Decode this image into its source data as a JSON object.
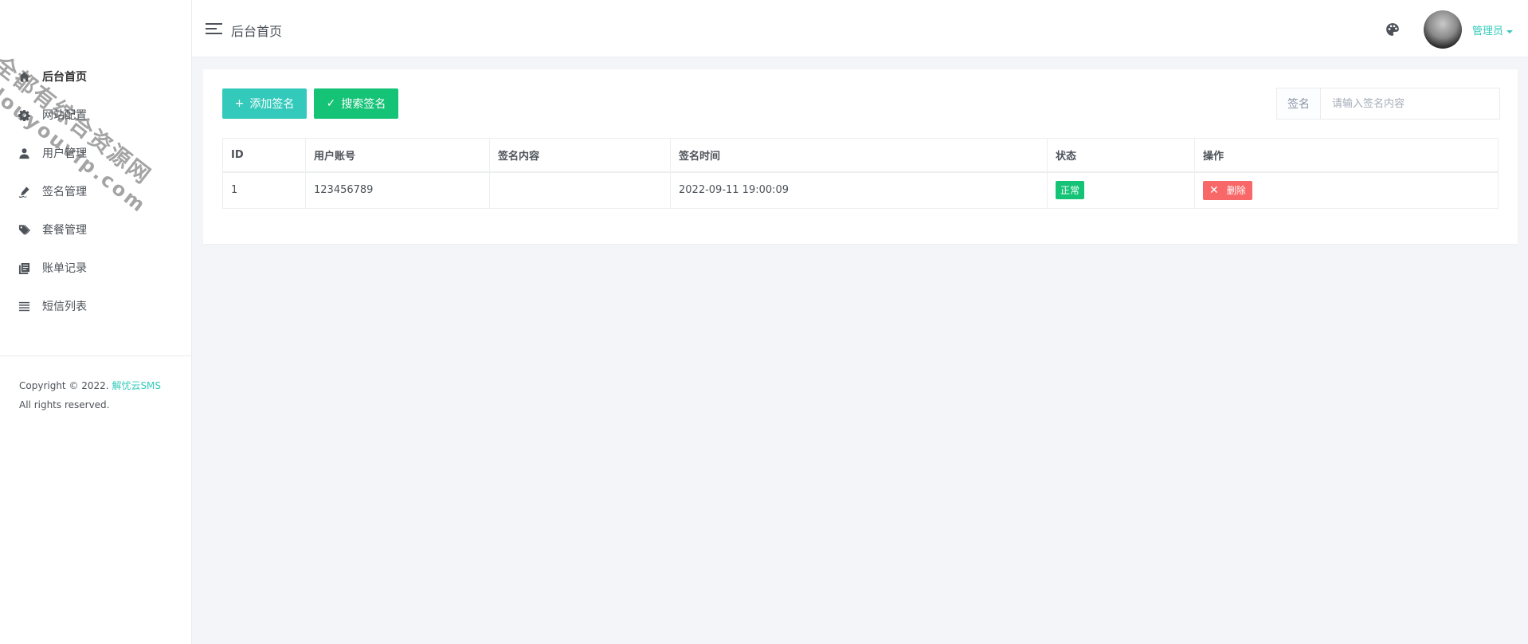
{
  "header": {
    "title": "后台首页",
    "user_name": "管理员"
  },
  "sidebar": {
    "logo": "",
    "items": [
      {
        "label": "后台首页",
        "icon": "home-icon"
      },
      {
        "label": "网站配置",
        "icon": "gear-icon"
      },
      {
        "label": "用户管理",
        "icon": "user-icon"
      },
      {
        "label": "签名管理",
        "icon": "signature-icon"
      },
      {
        "label": "套餐管理",
        "icon": "tags-icon"
      },
      {
        "label": "账单记录",
        "icon": "ledger-icon"
      },
      {
        "label": "短信列表",
        "icon": "list-icon"
      }
    ],
    "copyright_prefix": "Copyright © 2022. ",
    "copyright_brand": "解忧云SMS",
    "copyright_rights": "All rights reserved."
  },
  "toolbar": {
    "add_label": "添加签名",
    "search_label": "搜索签名",
    "search_field_label": "签名",
    "search_placeholder": "请输入签名内容"
  },
  "table": {
    "headers": [
      "ID",
      "用户账号",
      "签名内容",
      "签名时间",
      "状态",
      "操作"
    ],
    "rows": [
      {
        "id": "1",
        "account": "123456789",
        "content": "",
        "time": "2022-09-11 19:00:09",
        "status": "正常",
        "action": "删除"
      }
    ]
  },
  "watermark": {
    "line1": "全都有综合资源网",
    "line2": "douyouvip.com"
  },
  "colors": {
    "accent": "#33cabb",
    "success": "#15c377",
    "danger": "#f96868"
  }
}
